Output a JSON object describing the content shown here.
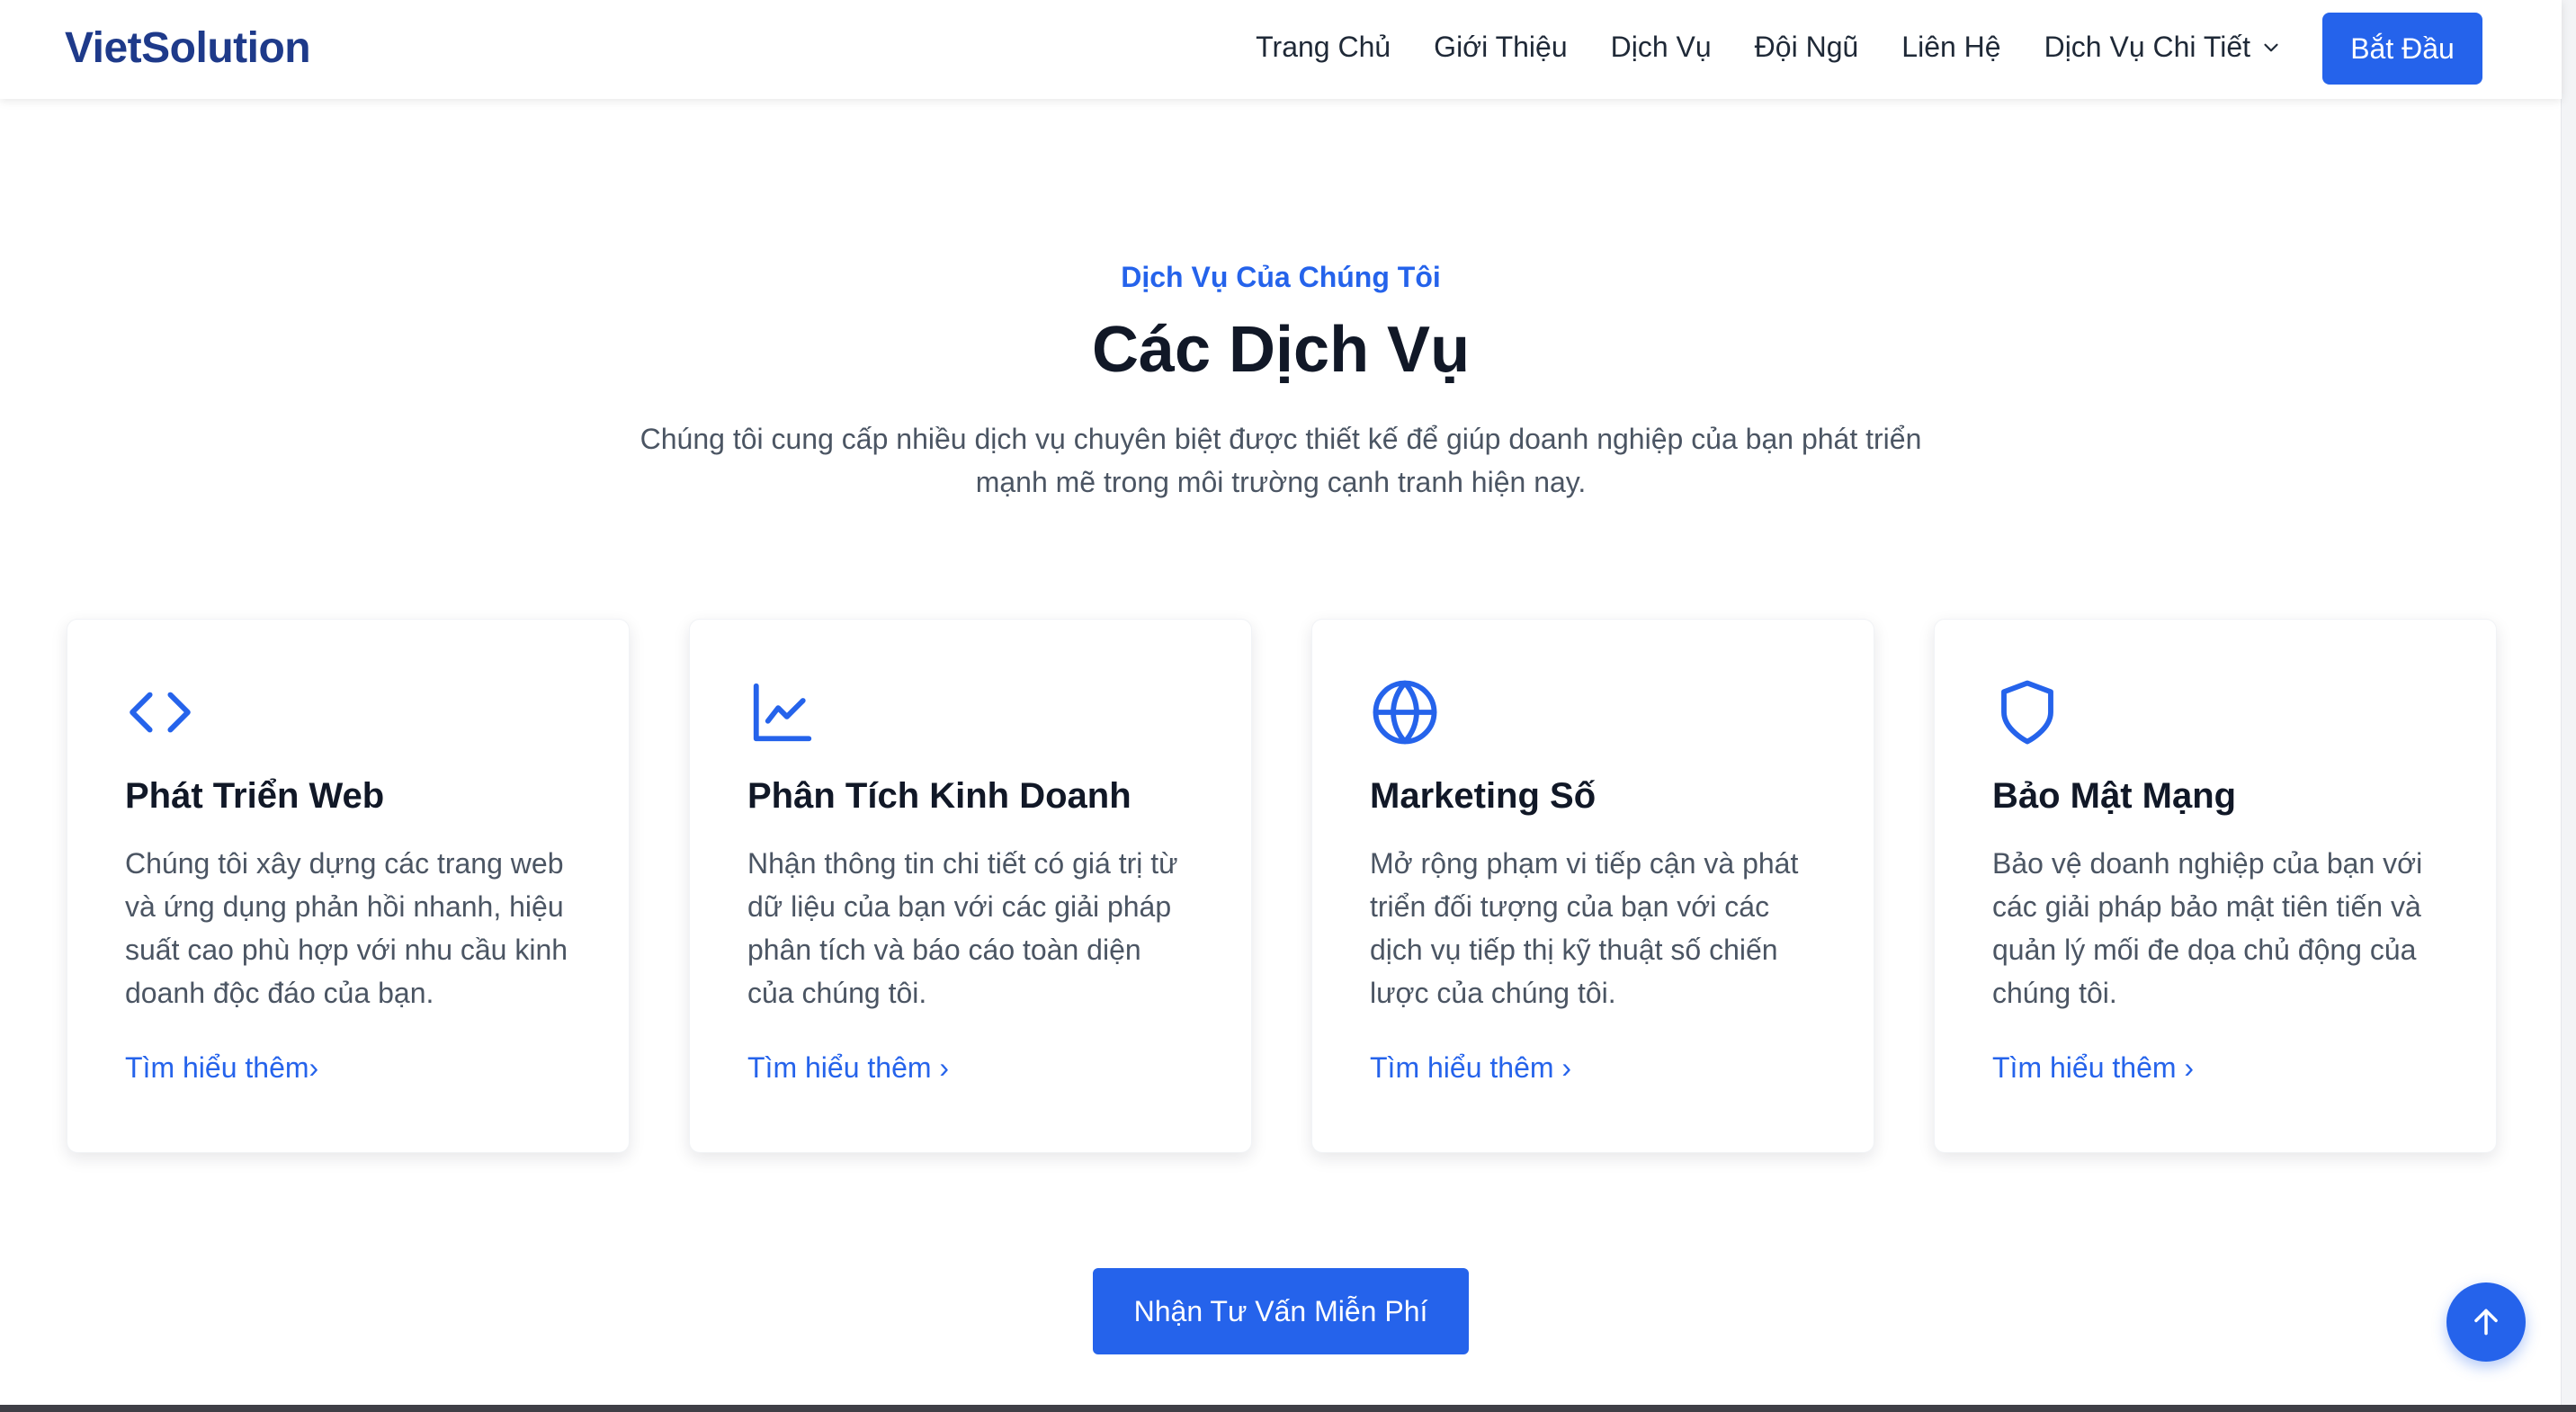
{
  "nav": {
    "brand": "VietSolution",
    "links": [
      "Trang Chủ",
      "Giới Thiệu",
      "Dịch Vụ",
      "Đội Ngũ",
      "Liên Hệ"
    ],
    "dropdown_label": "Dịch Vụ Chi Tiết",
    "cta": "Bắt Đầu"
  },
  "services": {
    "eyebrow": "Dịch Vụ Của Chúng Tôi",
    "title": "Các Dịch Vụ",
    "description": "Chúng tôi cung cấp nhiều dịch vụ chuyên biệt được thiết kế để giúp doanh nghiệp của bạn phát triển mạnh mẽ trong môi trường cạnh tranh hiện nay.",
    "cards": [
      {
        "icon": "code-icon",
        "title": "Phát Triển Web",
        "text": "Chúng tôi xây dựng các trang web và ứng dụng phản hồi nhanh, hiệu suất cao phù hợp với nhu cầu kinh doanh độc đáo của bạn.",
        "link": "Tìm hiểu thêm›"
      },
      {
        "icon": "chart-line-icon",
        "title": "Phân Tích Kinh Doanh",
        "text": "Nhận thông tin chi tiết có giá trị từ dữ liệu của bạn với các giải pháp phân tích và báo cáo toàn diện của chúng tôi.",
        "link": "Tìm hiểu thêm ›"
      },
      {
        "icon": "globe-icon",
        "title": "Marketing Số",
        "text": "Mở rộng phạm vi tiếp cận và phát triển đối tượng của bạn với các dịch vụ tiếp thị kỹ thuật số chiến lược của chúng tôi.",
        "link": "Tìm hiểu thêm ›"
      },
      {
        "icon": "shield-icon",
        "title": "Bảo Mật Mạng",
        "text": "Bảo vệ doanh nghiệp của bạn với các giải pháp bảo mật tiên tiến và quản lý mối đe dọa chủ động của chúng tôi.",
        "link": "Tìm hiểu thêm ›"
      }
    ],
    "cta": "Nhận Tư Vấn Miễn Phí"
  },
  "colors": {
    "primary": "#2563eb",
    "brand": "#1e3a8a",
    "heading": "#111827",
    "body": "#4b5563"
  },
  "icons": {
    "dropdown": "chevron-down-icon",
    "back_to_top": "arrow-up-icon"
  }
}
